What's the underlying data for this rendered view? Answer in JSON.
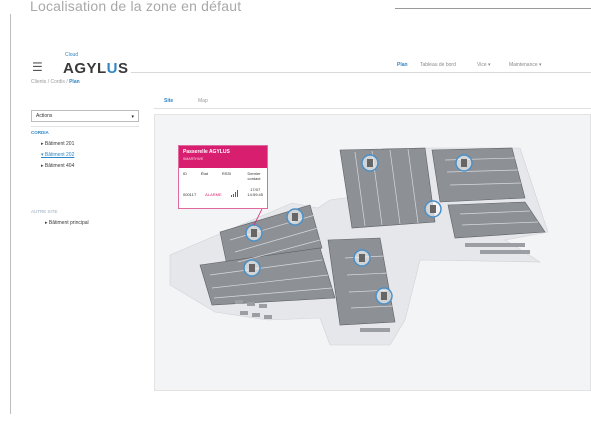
{
  "caption": "Localisation de la zone en défaut",
  "header": {
    "cloud_label": "Cloud",
    "logo_prefix": "AGYL",
    "logo_u": "U",
    "logo_suffix": "S",
    "nav": [
      "Plan",
      "Tableau de bord",
      "Vice ▾",
      "Maintenance ▾"
    ]
  },
  "breadcrumb": {
    "a": "Clients",
    "sep1": "/",
    "b": "Cordis",
    "sep2": "/",
    "c": "Plan"
  },
  "sidebar": {
    "actions_label": "Actions",
    "group1": "CORDIA",
    "group1_items": [
      "▸ Bâtiment 201",
      "▾ Bâtiment 202",
      "▸ Bâtiment 404"
    ],
    "group2": "AUTRE SITE",
    "group2_items": [
      "▸ Bâtiment principal"
    ]
  },
  "tabs": [
    "Site",
    "Map"
  ],
  "popup": {
    "title": "Passerelle AGYLUS",
    "subtitle": "SMARTHIVE",
    "col_id": "ID",
    "col_etat": "État",
    "col_rssi": "RSSI",
    "col_dernier": "Dernier contact",
    "val_id": "00011T",
    "val_etat": "ALARME",
    "val_date": "17/07",
    "val_time": "14:59:45"
  },
  "colors": {
    "accent": "#2f86c6",
    "alert": "#d81e6f"
  }
}
